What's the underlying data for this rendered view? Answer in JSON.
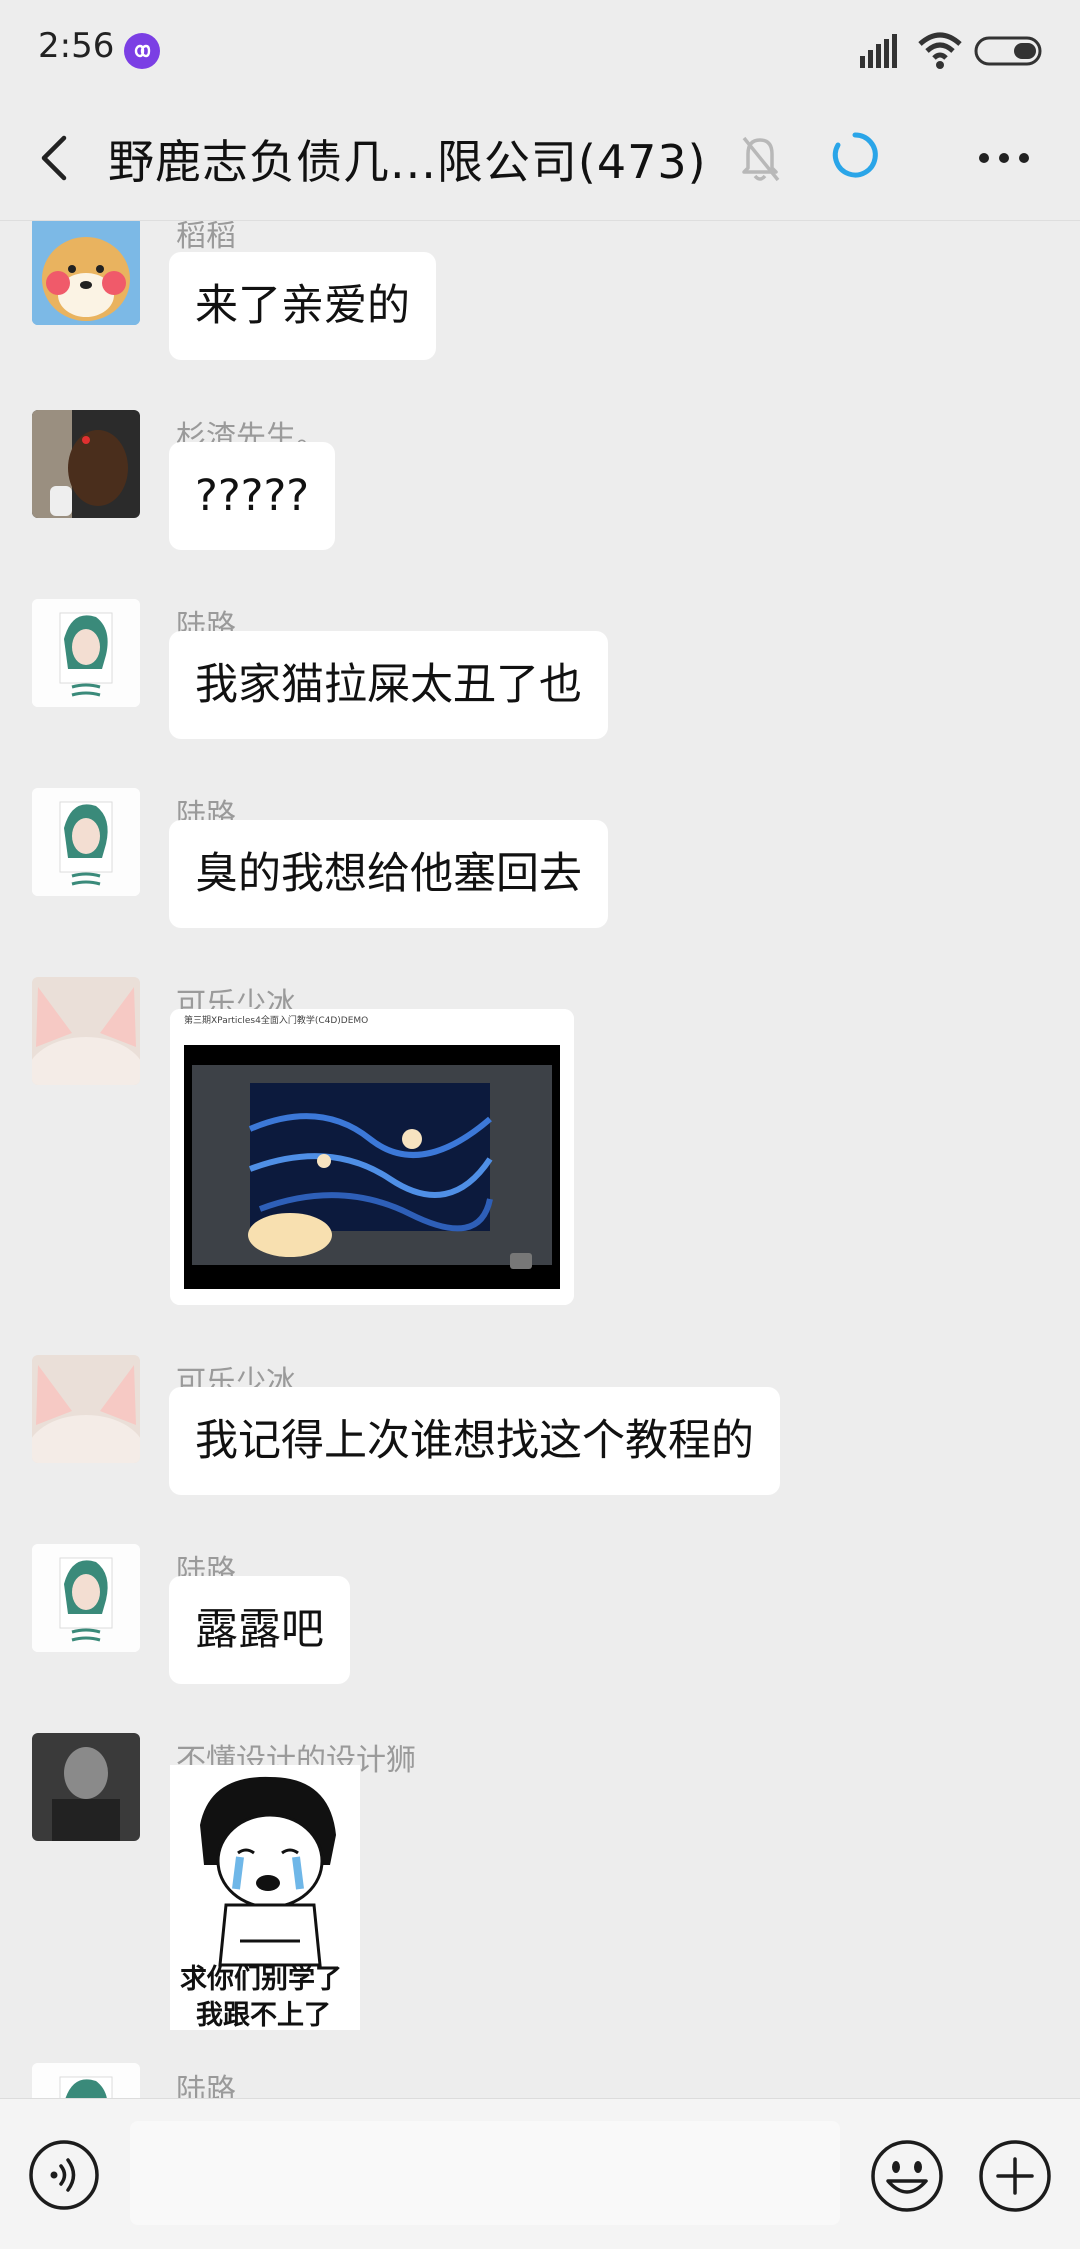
{
  "status_bar": {
    "time": "2:56"
  },
  "header": {
    "title": "野鹿志负债几...限公司(473)"
  },
  "messages": [
    {
      "sender": "稻稻",
      "text": "来了亲爱的"
    },
    {
      "sender": "杉渣先生。",
      "text": "?????"
    },
    {
      "sender": "陆路",
      "text": "我家猫拉屎太丑了也"
    },
    {
      "sender": "陆路",
      "text": "臭的我想给他塞回去"
    },
    {
      "sender": "可乐少冰",
      "video_title": "第三期XParticles4全面入门教学(C4D)DEMO"
    },
    {
      "sender": "可乐少冰",
      "text": "我记得上次谁想找这个教程的"
    },
    {
      "sender": "陆路",
      "text": "露露吧"
    },
    {
      "sender": "不懂设计的设计狮",
      "sticker_line1": "求你们别学了",
      "sticker_line2": "我跟不上了"
    },
    {
      "sender": "陆路"
    }
  ],
  "input": {
    "placeholder": ""
  },
  "colors": {
    "background": "#ededed",
    "bubble": "#ffffff",
    "accent_loading": "#2aa5e8",
    "app_badge": "#7b3fe4"
  },
  "icons": [
    "back-arrow-icon",
    "mute-bell-icon",
    "loading-icon",
    "more-icon",
    "voice-icon",
    "emoji-icon",
    "plus-icon"
  ]
}
